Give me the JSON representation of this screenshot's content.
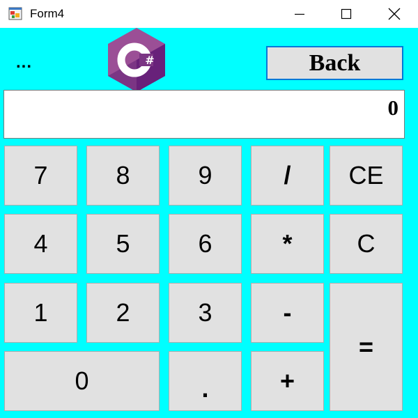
{
  "window": {
    "title": "Form4",
    "icon": "winforms-app-icon",
    "controls": [
      "minimize-icon",
      "maximize-icon",
      "close-icon"
    ]
  },
  "toolbar": {
    "ellipsis": "...",
    "logo": "csharp-logo-icon",
    "back_label": "Back"
  },
  "display": {
    "value": "0"
  },
  "keys": {
    "k7": "7",
    "k8": "8",
    "k9": "9",
    "div": "/",
    "ce": "CE",
    "k4": "4",
    "k5": "5",
    "k6": "6",
    "mul": "*",
    "clear": "C",
    "k1": "1",
    "k2": "2",
    "k3": "3",
    "sub": "-",
    "eq": "=",
    "k0": "0",
    "dot": ".",
    "add": "+"
  },
  "colors": {
    "client_background": "#00ffff",
    "button_face": "#e1e1e1",
    "focus_border": "#0078d7",
    "logo_purple": "#9b4f96",
    "logo_dark": "#68217a"
  }
}
